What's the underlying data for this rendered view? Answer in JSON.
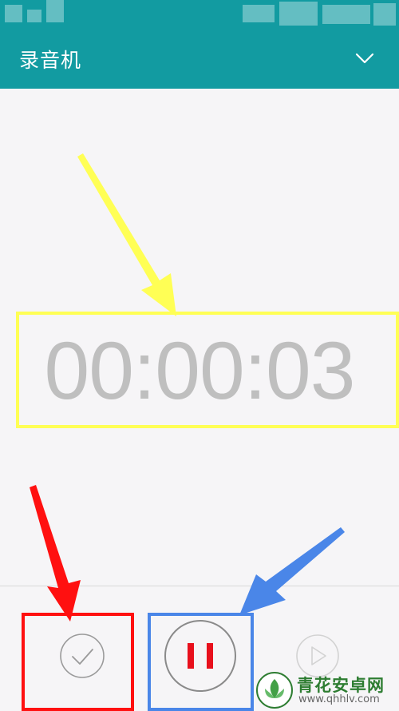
{
  "app": {
    "title": "录音机",
    "primary_color": "#129ba1"
  },
  "header": {
    "dropdown_icon": "chevron-down-icon"
  },
  "recorder": {
    "elapsed_time": "00:00:03",
    "time_color": "#bfbfbf"
  },
  "controls": {
    "finish_icon": "check-icon",
    "pause_icon": "pause-icon",
    "play_icon": "play-icon",
    "pause_color": "#e8101c"
  },
  "annotations": {
    "highlight_timer_color": "#ffff55",
    "highlight_finish_color": "#ff1010",
    "highlight_pause_color": "#4a86e8"
  },
  "watermark": {
    "name": "青花安卓网",
    "url": "www.qhhlv.com"
  }
}
